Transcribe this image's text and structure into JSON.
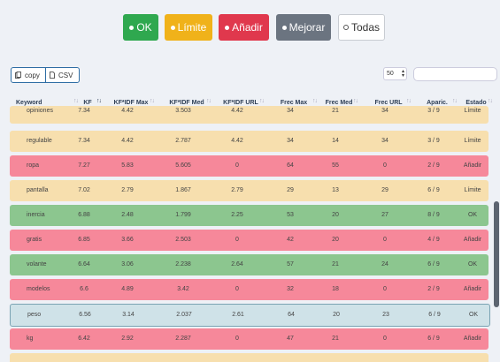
{
  "filters": [
    {
      "label": "OK",
      "color": "#2fa84f"
    },
    {
      "label": "Límite",
      "color": "#f0b21a"
    },
    {
      "label": "Añadir",
      "color": "#e0384d"
    },
    {
      "label": "Mejorar",
      "color": "#6b7480"
    },
    {
      "label": "Todas",
      "color": "#ffffff"
    }
  ],
  "toolbar": {
    "copy_label": "copy",
    "csv_label": "CSV"
  },
  "page_size": {
    "value": "50"
  },
  "search": {
    "placeholder": ""
  },
  "table": {
    "headers": [
      "Keyword",
      "KF",
      "KF*IDF Max",
      "KF*IDF Med",
      "KF*IDF URL",
      "Frec Max",
      "Frec Med",
      "Frec URL",
      "Aparic.",
      "Estado"
    ],
    "rows": [
      {
        "status": "limite",
        "cells": [
          "opiniones",
          "7.34",
          "4.42",
          "3.503",
          "4.42",
          "34",
          "21",
          "34",
          "3 / 9",
          "Límite"
        ]
      },
      {
        "status": "limite",
        "cells": [
          "regulable",
          "7.34",
          "4.42",
          "2.787",
          "4.42",
          "34",
          "14",
          "34",
          "3 / 9",
          "Límite"
        ]
      },
      {
        "status": "anadir",
        "cells": [
          "ropa",
          "7.27",
          "5.83",
          "5.605",
          "0",
          "64",
          "55",
          "0",
          "2 / 9",
          "Añadir"
        ]
      },
      {
        "status": "limite",
        "cells": [
          "pantalla",
          "7.02",
          "2.79",
          "1.867",
          "2.79",
          "29",
          "13",
          "29",
          "6 / 9",
          "Límite"
        ]
      },
      {
        "status": "ok",
        "cells": [
          "inercia",
          "6.88",
          "2.48",
          "1.799",
          "2.25",
          "53",
          "20",
          "27",
          "8 / 9",
          "OK"
        ]
      },
      {
        "status": "anadir",
        "cells": [
          "gratis",
          "6.85",
          "3.66",
          "2.503",
          "0",
          "42",
          "20",
          "0",
          "4 / 9",
          "Añadir"
        ]
      },
      {
        "status": "ok",
        "cells": [
          "volante",
          "6.64",
          "3.06",
          "2.238",
          "2.64",
          "57",
          "21",
          "24",
          "6 / 9",
          "OK"
        ]
      },
      {
        "status": "anadir",
        "cells": [
          "modelos",
          "6.6",
          "4.89",
          "3.42",
          "0",
          "32",
          "18",
          "0",
          "2 / 9",
          "Añadir"
        ]
      },
      {
        "status": "peso",
        "cells": [
          "peso",
          "6.56",
          "3.14",
          "2.037",
          "2.61",
          "64",
          "20",
          "23",
          "6 / 9",
          "OK"
        ]
      },
      {
        "status": "anadir",
        "cells": [
          "kg",
          "6.42",
          "2.92",
          "2.287",
          "0",
          "47",
          "21",
          "0",
          "6 / 9",
          "Añadir"
        ]
      },
      {
        "status": "limite",
        "cells": [
          "",
          "",
          "",
          "",
          "",
          "",
          "",
          "",
          "",
          ""
        ]
      }
    ]
  },
  "status_colors": {
    "ok": "#8cc68f",
    "limite": "#f7dfae",
    "anadir": "#f6889a",
    "peso": "#cfe2e8"
  }
}
